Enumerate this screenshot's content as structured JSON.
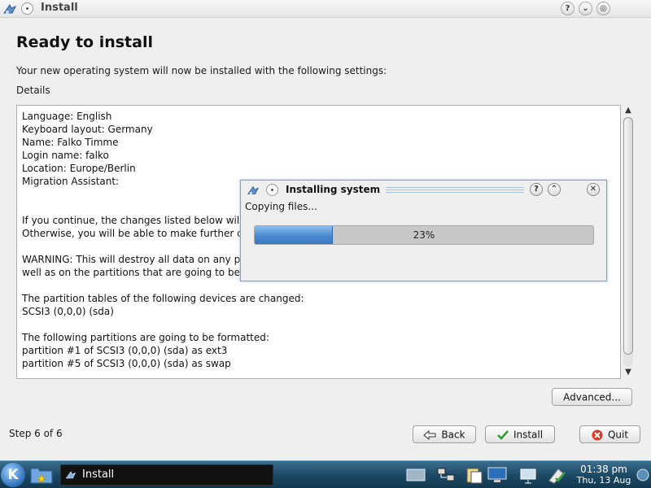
{
  "window": {
    "title": "Install"
  },
  "page": {
    "title": "Ready to install",
    "intro": "Your new operating system will now be installed with the following settings:",
    "details_label": "Details",
    "details_lines": [
      "Language: English",
      "Keyboard layout: Germany",
      "Name: Falko Timme",
      "Login name: falko",
      "Location: Europe/Berlin",
      "Migration Assistant:",
      "",
      "",
      "If you continue, the changes listed below wil",
      "Otherwise, you will be able to make further c",
      "",
      "WARNING: This will destroy all data on any p",
      "well as on the partitions that are going to be formatted.",
      "",
      "The partition tables of the following devices are changed:",
      "SCSI3 (0,0,0) (sda)",
      "",
      "The following partitions are going to be formatted:",
      "partition #1 of SCSI3 (0,0,0) (sda) as ext3",
      "partition #5 of SCSI3 (0,0,0) (sda) as swap"
    ]
  },
  "buttons": {
    "advanced": "Advanced...",
    "back": "Back",
    "install": "Install",
    "quit": "Quit"
  },
  "step": "Step 6 of 6",
  "dialog": {
    "title": "Installing system",
    "status": "Copying files...",
    "progress_percent": 23,
    "progress_label": "23%"
  },
  "taskbar": {
    "kmenu_label": "K",
    "task_label": "Install",
    "clock_time": "01:38 pm",
    "clock_date": "Thu, 13 Aug"
  },
  "colors": {
    "progress_fill": "#4a8bd0",
    "taskbar": "#1d4a66",
    "dialog_border": "#7fa3d1"
  }
}
